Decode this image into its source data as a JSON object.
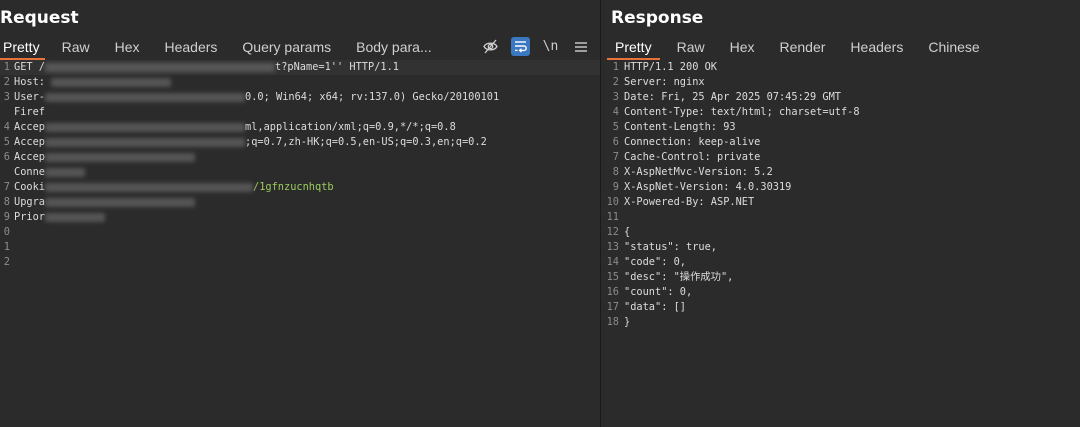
{
  "request": {
    "title": "Request",
    "tabs": [
      "Pretty",
      "Raw",
      "Hex",
      "Headers",
      "Query params",
      "Body para..."
    ],
    "toolbar_newline": "\\n",
    "line_numbers": [
      "1",
      "2",
      "3",
      "",
      "4",
      "5",
      "6",
      "",
      "7",
      "8",
      "9",
      "0",
      "1",
      "2"
    ],
    "lines": [
      {
        "prefix": "GET /",
        "suffix": "t?pName=1'' HTTP/1.1"
      },
      {
        "prefix": "Host:",
        "suffix": ""
      },
      {
        "prefix": "User-",
        "suffix": "0.0; Win64; x64; rv:137.0) Gecko/20100101"
      },
      {
        "prefix": "Firef",
        "suffix": ""
      },
      {
        "prefix": "Accep",
        "suffix": "ml,application/xml;q=0.9,*/*;q=0.8"
      },
      {
        "prefix": "Accep",
        "suffix": ";q=0.7,zh-HK;q=0.5,en-US;q=0.3,en;q=0.2"
      },
      {
        "prefix": "Accep",
        "suffix": ""
      },
      {
        "prefix": "Conne",
        "suffix": ""
      },
      {
        "prefix": "Cooki",
        "suffix": "/1gfnzucnhqtb"
      },
      {
        "prefix": "Upgra",
        "suffix": ""
      },
      {
        "prefix": "Prior",
        "suffix": ""
      },
      {
        "prefix": "",
        "suffix": ""
      },
      {
        "prefix": "",
        "suffix": ""
      },
      {
        "prefix": "",
        "suffix": ""
      }
    ]
  },
  "response": {
    "title": "Response",
    "tabs": [
      "Pretty",
      "Raw",
      "Hex",
      "Render",
      "Headers",
      "Chinese"
    ],
    "lines": [
      {
        "n": "1",
        "text": "HTTP/1.1 200 OK"
      },
      {
        "n": "2",
        "text": "Server: nginx"
      },
      {
        "n": "3",
        "text": "Date: Fri, 25 Apr 2025 07:45:29 GMT"
      },
      {
        "n": "4",
        "text": "Content-Type: text/html; charset=utf-8"
      },
      {
        "n": "5",
        "text": "Content-Length: 93"
      },
      {
        "n": "6",
        "text": "Connection: keep-alive"
      },
      {
        "n": "7",
        "text": "Cache-Control: private"
      },
      {
        "n": "8",
        "text": "X-AspNetMvc-Version: 5.2"
      },
      {
        "n": "9",
        "text": "X-AspNet-Version: 4.0.30319"
      },
      {
        "n": "10",
        "text": "X-Powered-By: ASP.NET"
      },
      {
        "n": "11",
        "text": ""
      },
      {
        "n": "12",
        "text": "{"
      },
      {
        "n": "13",
        "text": "\"status\": true,"
      },
      {
        "n": "14",
        "text": "\"code\": 0,"
      },
      {
        "n": "15",
        "text": "\"desc\": \"操作成功\","
      },
      {
        "n": "16",
        "text": "\"count\": 0,"
      },
      {
        "n": "17",
        "text": "\"data\": []"
      },
      {
        "n": "18",
        "text": "}"
      }
    ]
  }
}
